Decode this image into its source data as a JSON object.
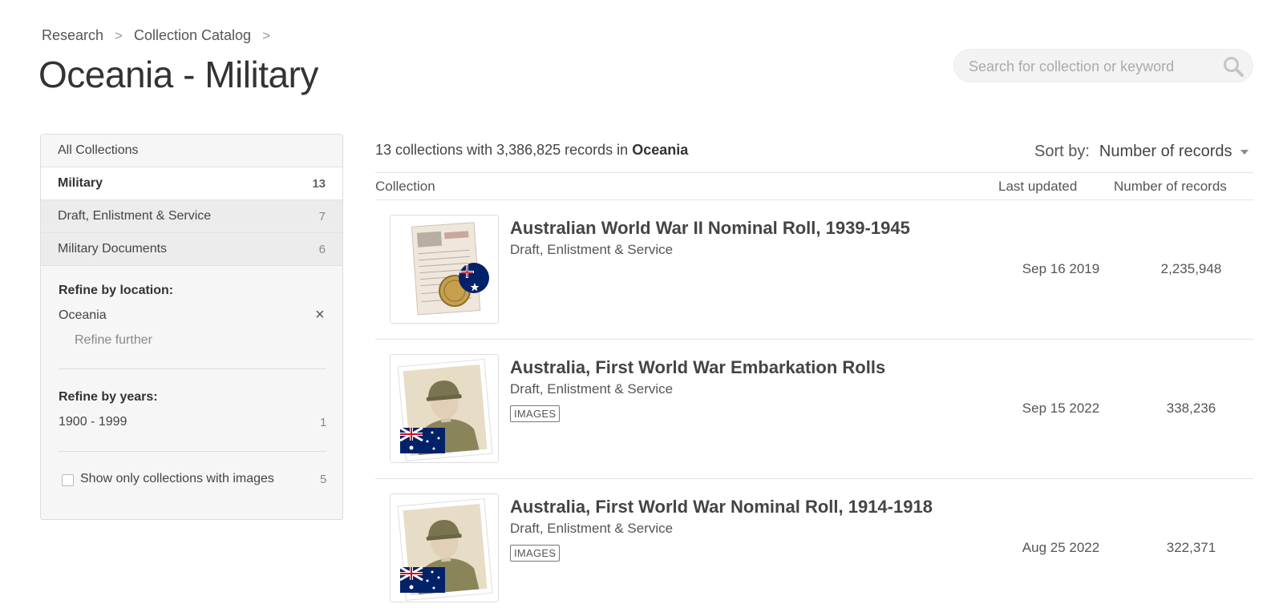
{
  "breadcrumb": {
    "items": [
      "Research",
      "Collection Catalog"
    ],
    "separator": ">"
  },
  "page_title": "Oceania - Military",
  "search": {
    "placeholder": "Search for collection or keyword",
    "icon": "search-icon"
  },
  "sidebar": {
    "all_label": "All Collections",
    "active": {
      "label": "Military",
      "count": "13"
    },
    "subcategories": [
      {
        "label": "Draft, Enlistment & Service",
        "count": "7"
      },
      {
        "label": "Military Documents",
        "count": "6"
      }
    ],
    "refine_location": {
      "heading": "Refine by location:",
      "value": "Oceania",
      "clear_symbol": "×",
      "further": "Refine further"
    },
    "refine_years": {
      "heading": "Refine by years:",
      "range": "1900 - 1999",
      "count": "1"
    },
    "images_filter": {
      "label": "Show only collections with images",
      "count": "5",
      "checked": false
    }
  },
  "summary": {
    "prefix": "13 collections with 3,386,825 records in",
    "location": "Oceania"
  },
  "sort": {
    "label": "Sort by:",
    "value": "Number of records"
  },
  "table": {
    "headers": {
      "collection": "Collection",
      "updated": "Last updated",
      "records": "Number of records"
    },
    "rows": [
      {
        "title": "Australian World War II Nominal Roll, 1939-1945",
        "category": "Draft, Enlistment & Service",
        "badge": "",
        "updated": "Sep 16 2019",
        "records": "2,235,948",
        "thumb": "document-medal-thumbnail"
      },
      {
        "title": "Australia, First World War Embarkation Rolls",
        "category": "Draft, Enlistment & Service",
        "badge": "IMAGES",
        "updated": "Sep 15 2022",
        "records": "338,236",
        "thumb": "soldier-flag-thumbnail"
      },
      {
        "title": "Australia, First World War Nominal Roll, 1914-1918",
        "category": "Draft, Enlistment & Service",
        "badge": "IMAGES",
        "updated": "Aug 25 2022",
        "records": "322,371",
        "thumb": "soldier-flag-thumbnail"
      }
    ]
  },
  "colors": {
    "accent_text": "#333333",
    "muted": "#888888",
    "sidebar_bg": "#f6f6f6",
    "flag_blue": "#012169",
    "flag_red": "#C8102E"
  }
}
